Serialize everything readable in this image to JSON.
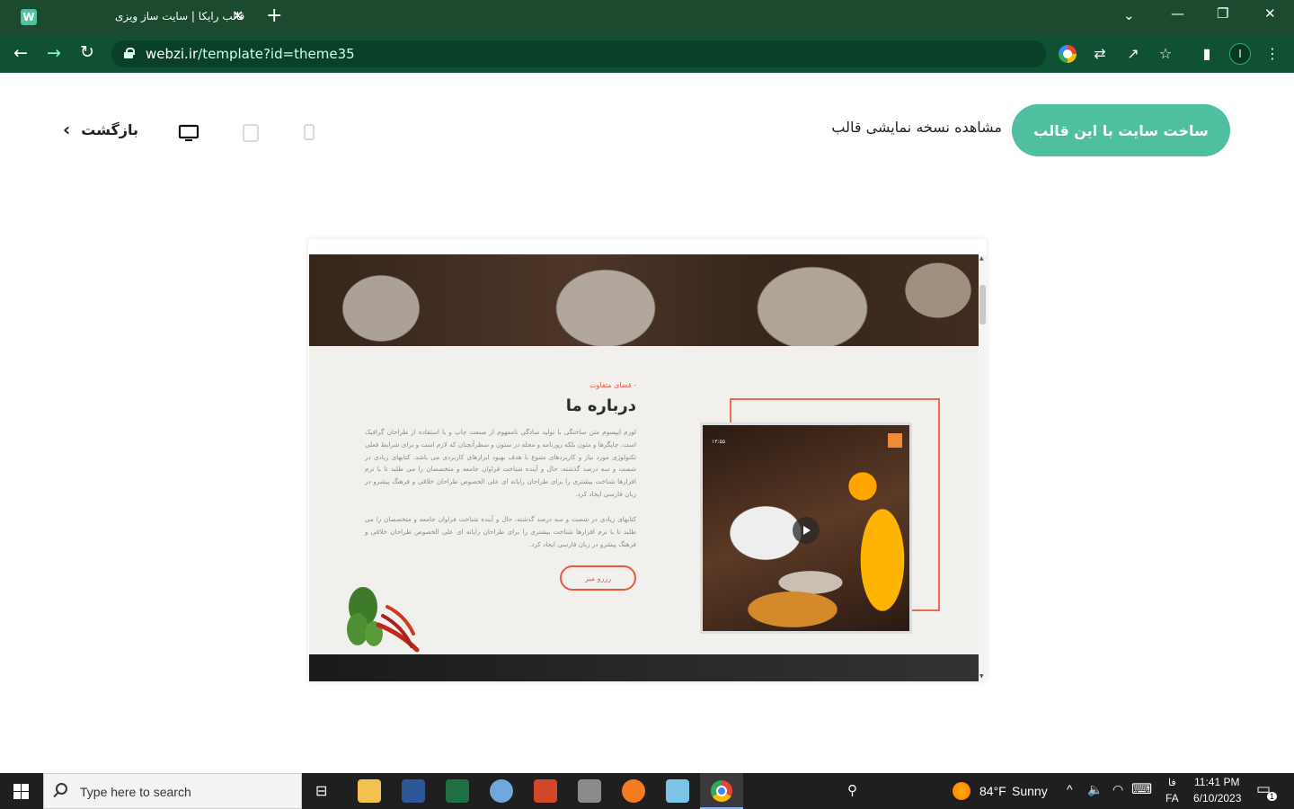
{
  "browser": {
    "tab_title": "قالب رایکا | سایت ساز ویزی",
    "favicon_letter": "W",
    "url_host": "webzi.ir",
    "url_path": "/template?id=theme35",
    "profile_initial": "I"
  },
  "header": {
    "cta_label": "ساخت سایت با این قالب",
    "demo_label": "مشاهده نسخه نمایشی قالب",
    "back_label": "بازگشت",
    "devices": [
      "desktop",
      "tablet",
      "mobile"
    ],
    "active_device": "desktop"
  },
  "preview": {
    "tagline": "- فضای متفاوت",
    "title": "درباره ما",
    "paragraph1": "لورم ایپسوم متن ساختگی با تولید سادگی نامفهوم از صنعت چاپ و با استفاده از طراحان گرافیک است. چاپگرها و متون بلکه روزنامه و مجله در ستون و سطرآنچنان که لازم است و برای شرایط فعلی تکنولوژی مورد نیاز و کاربردهای متنوع با هدف بهبود ابزارهای کاربردی می باشد. کتابهای زیادی در شصت و سه درصد گذشته، حال و آینده شناخت فراوان جامعه و متخصصان را می طلبد تا با نرم افزارها شناخت بیشتری را برای طراحان رایانه ای علی الخصوص طراحان خلاقی و فرهنگ پیشرو در زبان فارسی ایجاد کرد.",
    "paragraph2": "کتابهای زیادی در شصت و سه درصد گذشته، حال و آینده شناخت فراوان جامعه و متخصصان را می طلبد تا با نرم افزارها شناخت بیشتری را برای طراحان رایانه ای علی الخصوص طراحان خلاقی و فرهنگ پیشرو در زبان فارسی ایجاد کرد.",
    "reserve_label": "رزرو میز",
    "photo_time": "۱۳:۵۵"
  },
  "taskbar": {
    "search_placeholder": "Type here to search",
    "weather_temp": "84°F",
    "weather_text": "Sunny",
    "lang_top": "فا",
    "lang_bottom": "FA",
    "time": "11:41 PM",
    "date": "6/10/2023",
    "notification_count": "1"
  },
  "colors": {
    "chrome_dark": "#1c4a2e",
    "chrome_toolbar": "#0f5132",
    "cta_bg": "#4fbfa0",
    "accent_orange": "#e8593f"
  }
}
